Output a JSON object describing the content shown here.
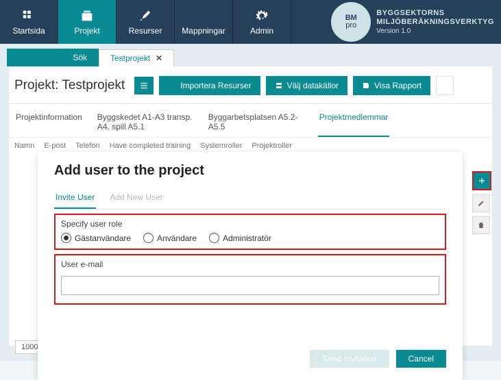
{
  "nav": {
    "items": [
      {
        "label": "Startsida",
        "icon": "home"
      },
      {
        "label": "Projekt",
        "icon": "factory",
        "active": true
      },
      {
        "label": "Resurser",
        "icon": "tools"
      },
      {
        "label": "Mappningar",
        "icon": "tools2"
      },
      {
        "label": "Admin",
        "icon": "gear"
      }
    ],
    "brand_line1": "BYGGSEKTORNS",
    "brand_line2": "MILJÖBERÄKNINGSVERKTYG",
    "brand_version": "Version 1.0",
    "brand_logo_top": "BM",
    "brand_logo_bottom": "pro"
  },
  "tabs": {
    "search": "Sök",
    "doc": "Testprojekt"
  },
  "titlebar": {
    "title": "Projekt: Testprojekt",
    "import": "Importera Resurser",
    "choose": "Välj datakällor",
    "report": "Visa Rapport",
    "ghost": " "
  },
  "sections": [
    "Projektinformation",
    "Byggskedet A1-A3 transp. A4, spill A5.1",
    "Byggarbetsplatsen A5.2-A5.5",
    "Projektmedlemmar"
  ],
  "columns": [
    "Namn",
    "E-post",
    "Telefon",
    "Have completed training",
    "Systemroller",
    "Projektroller"
  ],
  "count": "1000",
  "modal": {
    "title": "Add user to the project",
    "tabs": [
      "Invite User",
      "Add New User"
    ],
    "role_label": "Specify user role",
    "roles": [
      "Gästanvändare",
      "Användare",
      "Administratör"
    ],
    "email_label": "User e-mail",
    "send": "Send Invitation",
    "cancel": "Cancel"
  }
}
